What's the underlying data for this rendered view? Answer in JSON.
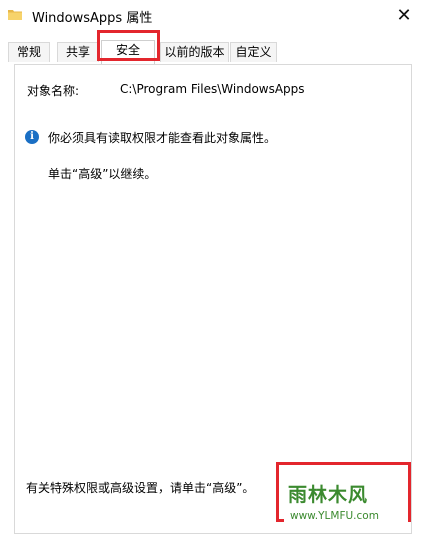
{
  "window": {
    "title": "WindowsApps 属性",
    "close_symbol": "✕"
  },
  "tabs": [
    {
      "label": "常规",
      "active": false
    },
    {
      "label": "共享",
      "active": false
    },
    {
      "label": "安全",
      "active": true
    },
    {
      "label": "以前的版本",
      "active": false
    },
    {
      "label": "自定义",
      "active": false
    }
  ],
  "security": {
    "object_name_label": "对象名称:",
    "object_name_value": "C:\\Program Files\\WindowsApps",
    "info_message": "你必须具有读取权限才能查看此对象属性。",
    "continue_hint": "单击“高级”以继续。",
    "advanced_hint": "有关特殊权限或高级设置，请单击“高级”。"
  },
  "icons": {
    "folder": "folder-icon",
    "info": "info-icon",
    "close": "close-icon"
  },
  "colors": {
    "highlight": "#e3262d",
    "info_blue": "#1a6fc4",
    "watermark_green": "#3b8a2f"
  },
  "watermark": {
    "main": "雨林木风",
    "url": "www.YLMFU.com"
  }
}
